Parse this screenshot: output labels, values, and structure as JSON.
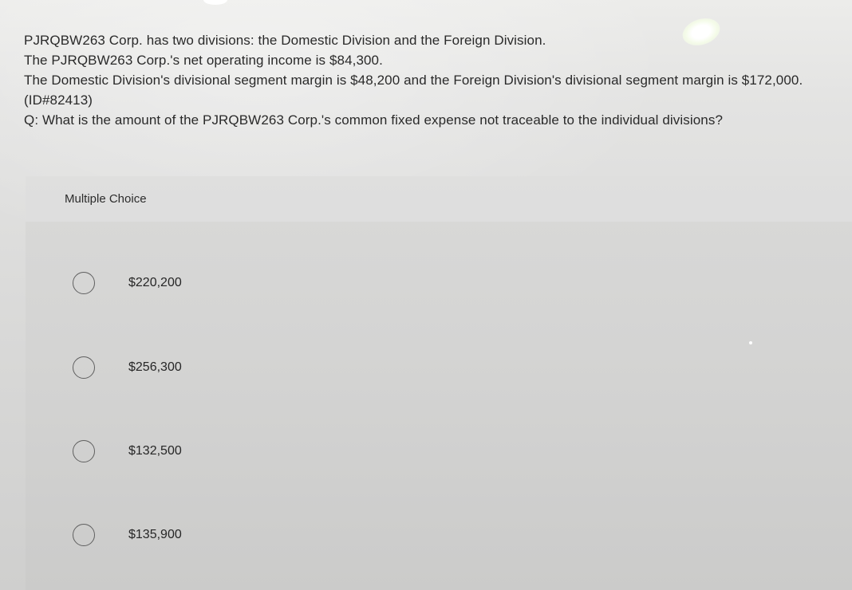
{
  "question": {
    "lines": [
      "PJRQBW263 Corp. has two divisions: the Domestic Division and the Foreign Division.",
      "The PJRQBW263 Corp.'s net operating income is $84,300.",
      "The Domestic Division's divisional segment margin is $48,200 and the Foreign Division's divisional segment margin is $172,000.",
      "(ID#82413)",
      "Q: What is the amount of the PJRQBW263 Corp.'s common fixed expense not traceable to the individual divisions?"
    ]
  },
  "multiple_choice": {
    "title": "Multiple Choice",
    "options": [
      {
        "label": "$220,200"
      },
      {
        "label": "$256,300"
      },
      {
        "label": "$132,500"
      },
      {
        "label": "$135,900"
      }
    ]
  },
  "colors": {
    "text": "#2a2a2a",
    "panel": "#d3d3d2",
    "radio_border": "#5f5f5f"
  }
}
